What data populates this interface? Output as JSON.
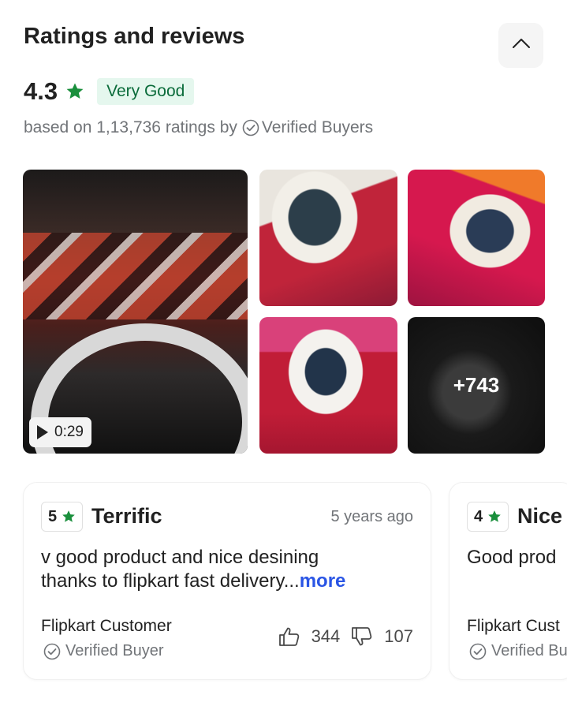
{
  "section": {
    "title": "Ratings and reviews",
    "collapse_icon": "chevron-up-icon"
  },
  "summary": {
    "rating": "4.3",
    "label": "Very Good",
    "based_prefix": "based on 1,13,736 ratings by",
    "verified_text": "Verified Buyers",
    "accent_color": "#1a8f3c"
  },
  "media": {
    "video_duration": "0:29",
    "more_count": "+743"
  },
  "reviews": [
    {
      "rating": "5",
      "title": "Terrific",
      "time_ago": "5 years ago",
      "body_line1": "v good product and nice desining",
      "body_line2": "thanks to flipkart fast delivery...",
      "more": "more",
      "author": "Flipkart Customer",
      "verified": "Verified Buyer",
      "likes": "344",
      "dislikes": "107"
    },
    {
      "rating": "4",
      "title": "Nice",
      "body_line1": "Good prod",
      "author": "Flipkart Cust",
      "verified": "Verified Bu"
    }
  ]
}
